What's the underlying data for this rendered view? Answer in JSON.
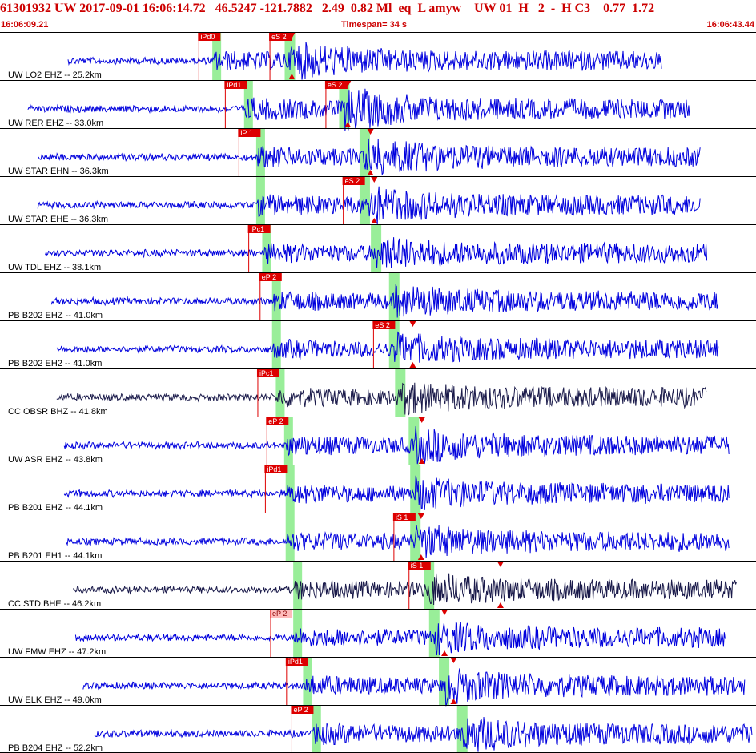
{
  "header": {
    "title": "61301932 UW 2017-09-01 16:06:14.72   46.5247 -121.7882   2.49  0.82 Ml  eq  L amyw    UW 01  H   2  -  H C3    0.77  1.72",
    "start_time": "16:06:09.21",
    "timespan": "Timespan=  34 s",
    "end_time": "16:06:43.44"
  },
  "colors": {
    "trace_blue": "#0000dd",
    "trace_black": "#1a1a4a",
    "pick_red": "#dd0000",
    "pick_pink": "#ffbbbb",
    "window_green": "#99ee99",
    "border": "#000000"
  },
  "traces": [
    {
      "label": "UW LO2 EHZ -- 25.2km",
      "color": "blue",
      "start": 0.09,
      "end": 0.875,
      "p": 0.283,
      "s": 0.384,
      "amp": 0.4,
      "picks": [
        {
          "text": "iPd0",
          "pos": 0.262,
          "style": "red"
        },
        {
          "text": "eS 2",
          "pos": 0.356,
          "style": "red"
        }
      ],
      "markers": [
        0.386
      ]
    },
    {
      "label": "UW RER EHZ -- 33.0km",
      "color": "blue",
      "start": 0.037,
      "end": 0.913,
      "p": 0.325,
      "s": 0.456,
      "amp": 0.5,
      "picks": [
        {
          "text": "iPd1",
          "pos": 0.297,
          "style": "red"
        },
        {
          "text": "eS 2",
          "pos": 0.43,
          "style": "red"
        }
      ],
      "markers": [
        0.46
      ]
    },
    {
      "label": "UW STAR EHN -- 36.3km",
      "color": "blue",
      "start": 0.05,
      "end": 0.927,
      "p": 0.341,
      "s": 0.483,
      "amp": 0.45,
      "picks": [
        {
          "text": "iP 1",
          "pos": 0.315,
          "style": "red"
        }
      ],
      "markers": [
        0.49
      ]
    },
    {
      "label": "UW STAR EHE -- 36.3km",
      "color": "blue",
      "start": 0.05,
      "end": 0.927,
      "p": 0.341,
      "s": 0.483,
      "amp": 0.45,
      "picks": [
        {
          "text": "eS 2",
          "pos": 0.453,
          "style": "red"
        }
      ],
      "markers": [
        0.495
      ]
    },
    {
      "label": "UW TDL EHZ -- 38.1km",
      "color": "blue",
      "start": 0.06,
      "end": 0.935,
      "p": 0.349,
      "s": 0.498,
      "amp": 0.35,
      "picks": [
        {
          "text": "iPc1",
          "pos": 0.328,
          "style": "red"
        }
      ],
      "markers": []
    },
    {
      "label": "PB B202 EHZ -- 41.0km",
      "color": "blue",
      "start": 0.068,
      "end": 0.95,
      "p": 0.362,
      "s": 0.522,
      "amp": 0.35,
      "picks": [
        {
          "text": "eP 2",
          "pos": 0.343,
          "style": "red"
        }
      ],
      "markers": []
    },
    {
      "label": "PB B202 EH2 -- 41.0km",
      "color": "blue",
      "start": 0.075,
      "end": 0.95,
      "p": 0.362,
      "s": 0.522,
      "amp": 0.3,
      "picks": [
        {
          "text": "eS 2",
          "pos": 0.493,
          "style": "red"
        }
      ],
      "markers": [
        0.546
      ]
    },
    {
      "label": "CC OBSR BHZ -- 41.8km",
      "color": "black",
      "start": 0.075,
      "end": 0.935,
      "p": 0.367,
      "s": 0.53,
      "amp": 0.35,
      "picks": [
        {
          "text": "iPc1",
          "pos": 0.34,
          "style": "red"
        }
      ],
      "markers": []
    },
    {
      "label": "UW ASR EHZ -- 43.8km",
      "color": "blue",
      "start": 0.085,
      "end": 0.965,
      "p": 0.378,
      "s": 0.548,
      "amp": 0.4,
      "picks": [
        {
          "text": "eP 2",
          "pos": 0.352,
          "style": "red"
        }
      ],
      "markers": [
        0.558
      ]
    },
    {
      "label": "PB B201 EHZ -- 44.1km",
      "color": "blue",
      "start": 0.085,
      "end": 0.965,
      "p": 0.38,
      "s": 0.55,
      "amp": 0.35,
      "picks": [
        {
          "text": "iPd1",
          "pos": 0.35,
          "style": "red"
        }
      ],
      "markers": []
    },
    {
      "label": "PB B201 EH1 -- 44.1km",
      "color": "blue",
      "start": 0.088,
      "end": 0.965,
      "p": 0.38,
      "s": 0.55,
      "amp": 0.35,
      "picks": [
        {
          "text": "iS 1",
          "pos": 0.52,
          "style": "red"
        }
      ],
      "markers": [
        0.557
      ]
    },
    {
      "label": "CC STD BHE -- 46.2km",
      "color": "black",
      "start": 0.097,
      "end": 0.975,
      "p": 0.39,
      "s": 0.568,
      "amp": 0.35,
      "picks": [
        {
          "text": "iS 1",
          "pos": 0.54,
          "style": "red"
        }
      ],
      "markers": [
        0.662
      ]
    },
    {
      "label": "UW FMW EHZ -- 47.2km",
      "color": "blue",
      "start": 0.1,
      "end": 0.96,
      "p": 0.39,
      "s": 0.575,
      "amp": 0.35,
      "picks": [
        {
          "text": "eP 2",
          "pos": 0.357,
          "style": "pink"
        }
      ],
      "markers": [
        0.588
      ]
    },
    {
      "label": "UW ELK EHZ -- 49.0km",
      "color": "blue",
      "start": 0.11,
      "end": 0.985,
      "p": 0.403,
      "s": 0.588,
      "amp": 0.4,
      "picks": [
        {
          "text": "iPd1",
          "pos": 0.378,
          "style": "red"
        }
      ],
      "markers": [
        0.6
      ]
    },
    {
      "label": "PB B204 EHZ -- 52.2km",
      "color": "blue",
      "start": 0.125,
      "end": 0.995,
      "p": 0.415,
      "s": 0.612,
      "amp": 0.45,
      "picks": [
        {
          "text": "eP 2",
          "pos": 0.385,
          "style": "red"
        }
      ],
      "markers": []
    }
  ]
}
